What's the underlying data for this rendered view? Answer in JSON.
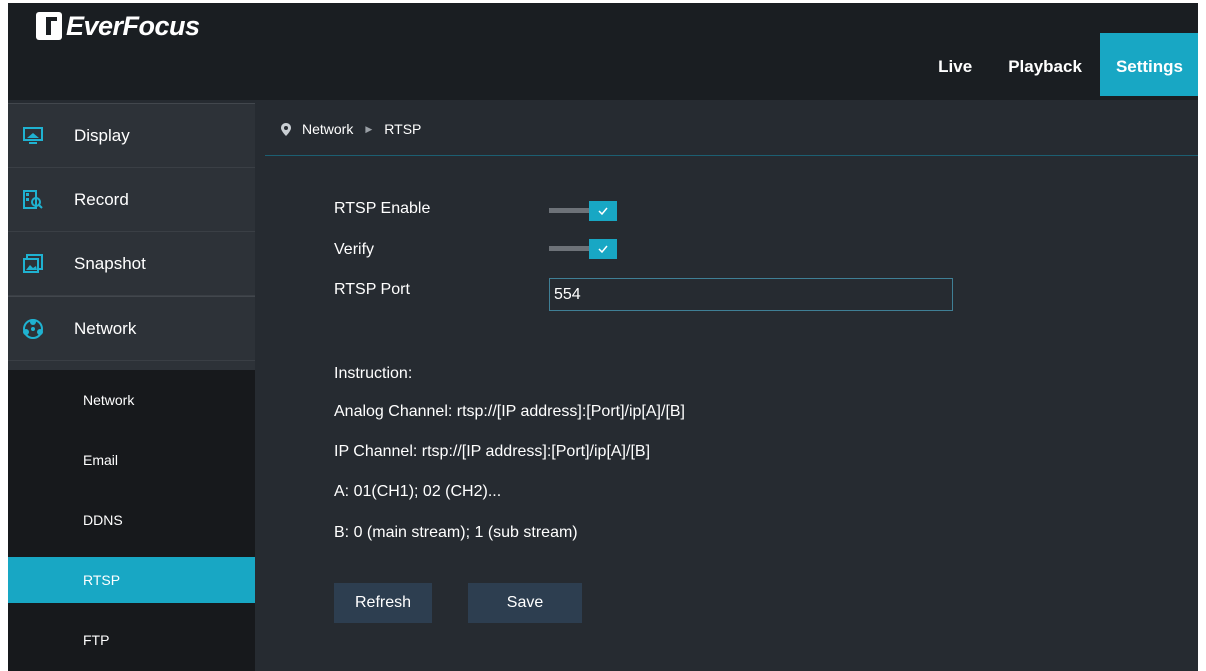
{
  "brand": {
    "name": "EverFocus"
  },
  "top_nav": [
    {
      "label": "Live"
    },
    {
      "label": "Playback"
    },
    {
      "label": "Settings"
    }
  ],
  "sidebar": {
    "main_items": [
      {
        "label": "Display",
        "icon": "monitor-icon"
      },
      {
        "label": "Record",
        "icon": "record-search-icon"
      },
      {
        "label": "Snapshot",
        "icon": "snapshot-icon"
      },
      {
        "label": "Network",
        "icon": "network-globe-icon"
      }
    ],
    "sub_items": [
      {
        "label": "Network"
      },
      {
        "label": "Email"
      },
      {
        "label": "DDNS"
      },
      {
        "label": "RTSP"
      },
      {
        "label": "FTP"
      }
    ],
    "active_sub": "RTSP"
  },
  "breadcrumb": {
    "section": "Network",
    "page": "RTSP"
  },
  "form": {
    "rtsp_enable_label": "RTSP Enable",
    "rtsp_enable_checked": true,
    "verify_label": "Verify",
    "verify_checked": true,
    "rtsp_port_label": "RTSP Port",
    "rtsp_port_value": "554"
  },
  "instructions": {
    "title": "Instruction:",
    "lines": [
      "Analog Channel: rtsp://[IP address]:[Port]/ip[A]/[B]",
      "IP Channel: rtsp://[IP address]:[Port]/ip[A]/[B]",
      "A: 01(CH1); 02 (CH2)...",
      "B: 0 (main stream); 1 (sub stream)"
    ]
  },
  "buttons": {
    "refresh": "Refresh",
    "save": "Save"
  },
  "colors": {
    "accent": "#18a7c4",
    "background": "#262b31",
    "header": "#1a1e22",
    "button": "#2d3e50"
  }
}
